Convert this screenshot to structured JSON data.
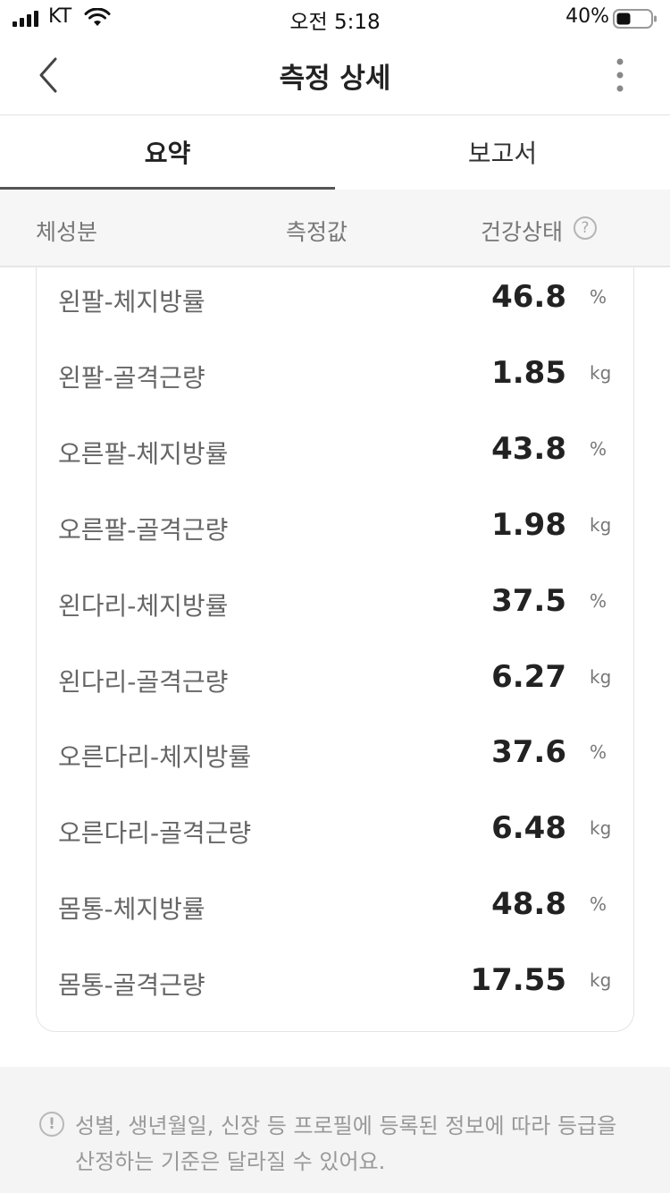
{
  "status_bar": {
    "carrier": "KT",
    "time": "오전 5:18",
    "battery": "40%"
  },
  "nav": {
    "title": "측정 상세"
  },
  "tabs": [
    {
      "label": "요약",
      "selected": true
    },
    {
      "label": "보고서",
      "selected": false
    }
  ],
  "columns": {
    "component": "체성분",
    "value": "측정값",
    "health": "건강상태"
  },
  "rows": [
    {
      "label": "왼팔-체지방률",
      "value": "46.8",
      "unit": "%"
    },
    {
      "label": "왼팔-골격근량",
      "value": "1.85",
      "unit": "kg"
    },
    {
      "label": "오른팔-체지방률",
      "value": "43.8",
      "unit": "%"
    },
    {
      "label": "오른팔-골격근량",
      "value": "1.98",
      "unit": "kg"
    },
    {
      "label": "왼다리-체지방률",
      "value": "37.5",
      "unit": "%"
    },
    {
      "label": "왼다리-골격근량",
      "value": "6.27",
      "unit": "kg"
    },
    {
      "label": "오른다리-체지방률",
      "value": "37.6",
      "unit": "%"
    },
    {
      "label": "오른다리-골격근량",
      "value": "6.48",
      "unit": "kg"
    },
    {
      "label": "몸통-체지방률",
      "value": "48.8",
      "unit": "%"
    },
    {
      "label": "몸통-골격근량",
      "value": "17.55",
      "unit": "kg"
    }
  ],
  "notice": {
    "text": "성별, 생년월일, 신장 등 프로필에 등록된 정보에 따라 등급을 산정하는 기준은 달라질 수 있어요."
  }
}
